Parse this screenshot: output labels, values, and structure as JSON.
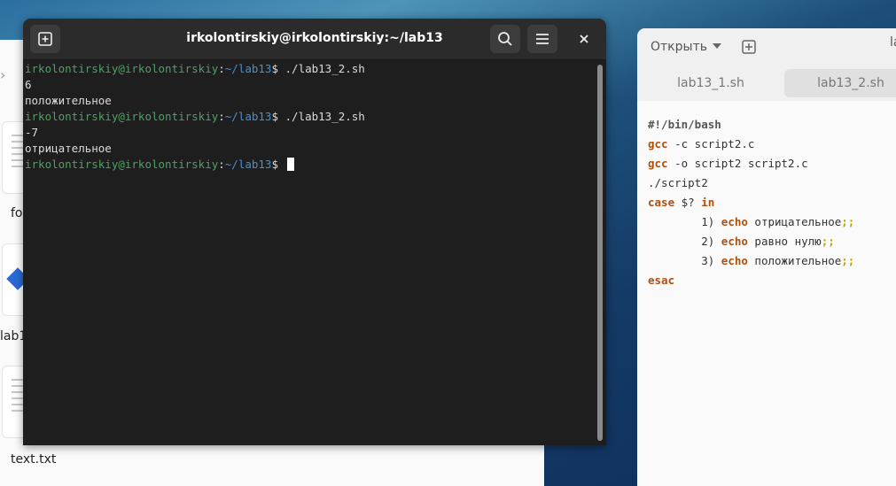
{
  "file_manager": {
    "items": [
      {
        "label": "fo"
      },
      {
        "label": "lab1"
      },
      {
        "label": "text.txt"
      }
    ]
  },
  "terminal": {
    "title": "irkolontirskiy@irkolontirskiy:~/lab13",
    "lines": [
      {
        "type": "prompt",
        "user": "irkolontirskiy@irkolontirskiy",
        "sep": ":",
        "path": "~/lab13",
        "cmd": "$ ./lab13_2.sh"
      },
      {
        "type": "output",
        "text": "6"
      },
      {
        "type": "output",
        "text": "положительное"
      },
      {
        "type": "prompt",
        "user": "irkolontirskiy@irkolontirskiy",
        "sep": ":",
        "path": "~/lab13",
        "cmd": "$ ./lab13_2.sh"
      },
      {
        "type": "output",
        "text": "-7"
      },
      {
        "type": "output",
        "text": "отрицательное"
      },
      {
        "type": "prompt",
        "user": "irkolontirskiy@irkolontirskiy",
        "sep": ":",
        "path": "~/lab13",
        "cmd": "$ "
      }
    ],
    "icons": {
      "new_tab": "new-tab-icon",
      "search": "search-icon",
      "menu": "hamburger-menu-icon",
      "close": "close-icon"
    }
  },
  "editor": {
    "open_label": "Открыть",
    "partial_title": "la",
    "tabs": [
      {
        "label": "lab13_1.sh",
        "active": false
      },
      {
        "label": "lab13_2.sh",
        "active": true
      }
    ],
    "code": {
      "l1": "#!/bin/bash",
      "l2_kw": "gcc",
      "l2_rest": " -c script2.c",
      "l3_kw": "gcc",
      "l3_rest": " -o script2 script2.c",
      "l4": "./script2",
      "l5_kw": "case",
      "l5_var": " $? ",
      "l5_kw2": "in",
      "l6_pre": "        1) ",
      "l6_kw": "echo",
      "l6_txt": " отрицательное",
      "l6_end": ";;",
      "l7_pre": "        2) ",
      "l7_kw": "echo",
      "l7_txt": " равно нулю",
      "l7_end": ";;",
      "l8_pre": "        3) ",
      "l8_kw": "echo",
      "l8_txt": " положительное",
      "l8_end": ";;",
      "l9_kw": "esac"
    }
  }
}
